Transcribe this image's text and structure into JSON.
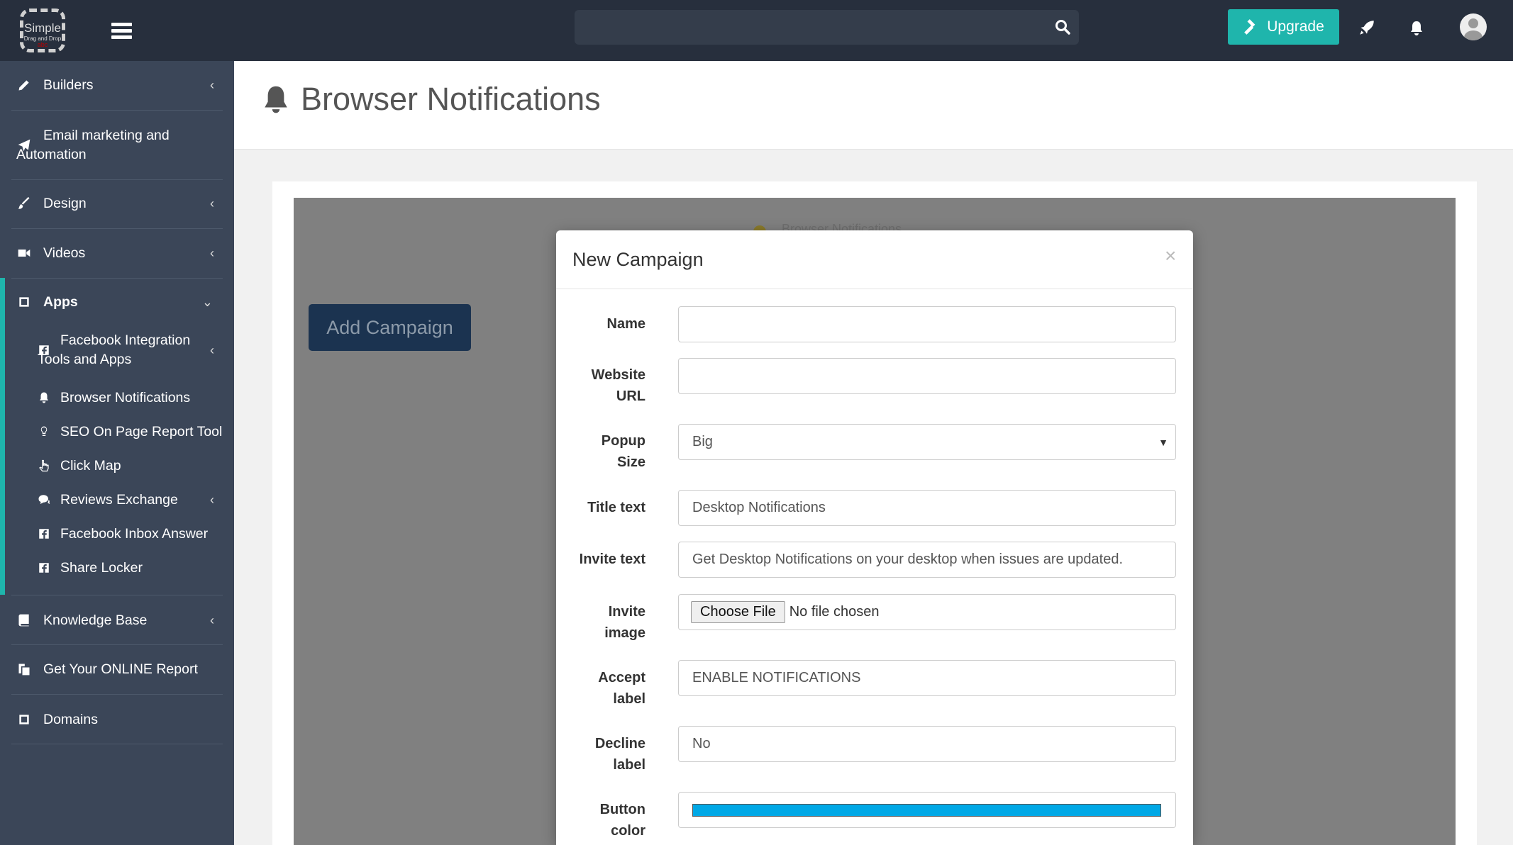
{
  "topbar": {
    "logo_text": "Simple",
    "logo_sub": "Drag and Drop",
    "logo_mark": "abc",
    "search_placeholder": "",
    "upgrade_label": "Upgrade"
  },
  "sidebar": {
    "items": [
      {
        "label": "Builders",
        "icon": "pencil-icon",
        "chevron": "‹"
      },
      {
        "label": "Email marketing and",
        "label2": "Automation",
        "icon": "paper-plane-icon"
      },
      {
        "label": "Design",
        "icon": "brush-icon",
        "chevron": "‹"
      },
      {
        "label": "Videos",
        "icon": "video-camera-icon",
        "chevron": "‹"
      },
      {
        "label": "Apps",
        "icon": "square-icon",
        "chevron": "⌄"
      },
      {
        "label": "Knowledge Base",
        "icon": "book-icon",
        "chevron": "‹"
      },
      {
        "label": "Get Your ONLINE Report",
        "icon": "copy-icon"
      },
      {
        "label": "Domains",
        "icon": "square-icon"
      }
    ],
    "apps_sub": [
      {
        "label": "Facebook Integration",
        "label2": "Tools and Apps",
        "icon": "facebook-icon",
        "chevron": "‹"
      },
      {
        "label": "Browser Notifications",
        "icon": "bell-icon"
      },
      {
        "label": "SEO On Page Report Tool",
        "icon": "lightbulb-icon"
      },
      {
        "label": "Click Map",
        "icon": "hand-pointer-icon"
      },
      {
        "label": "Reviews Exchange",
        "icon": "comments-icon",
        "chevron": "‹"
      },
      {
        "label": "Facebook Inbox Answer",
        "icon": "facebook-icon"
      },
      {
        "label": "Share Locker",
        "icon": "facebook-icon"
      }
    ]
  },
  "page": {
    "title": "Browser Notifications",
    "background_title": "Browser Notifications",
    "add_campaign_label": "Add Campaign"
  },
  "modal": {
    "title": "New Campaign",
    "close": "×",
    "fields": {
      "name": {
        "label": "Name",
        "value": ""
      },
      "website": {
        "label1": "Website",
        "label2": "URL",
        "value": ""
      },
      "popup": {
        "label1": "Popup",
        "label2": "Size",
        "value": "Big"
      },
      "title_text": {
        "label": "Title text",
        "value": "Desktop Notifications"
      },
      "invite_text": {
        "label": "Invite text",
        "value": "Get Desktop Notifications on your desktop when issues are updated."
      },
      "invite_image": {
        "label1": "Invite",
        "label2": "image",
        "button": "Choose File",
        "status": "No file chosen"
      },
      "accept": {
        "label1": "Accept",
        "label2": "label",
        "value": "ENABLE NOTIFICATIONS"
      },
      "decline": {
        "label1": "Decline",
        "label2": "label",
        "value": "No"
      },
      "button_color": {
        "label1": "Button",
        "label2": "color",
        "value": "#00a8e6"
      }
    }
  },
  "colors": {
    "topbar": "#272f3d",
    "sidebar": "#3b4658",
    "accent": "#1fb5ac",
    "add_campaign": "#1b3350"
  }
}
